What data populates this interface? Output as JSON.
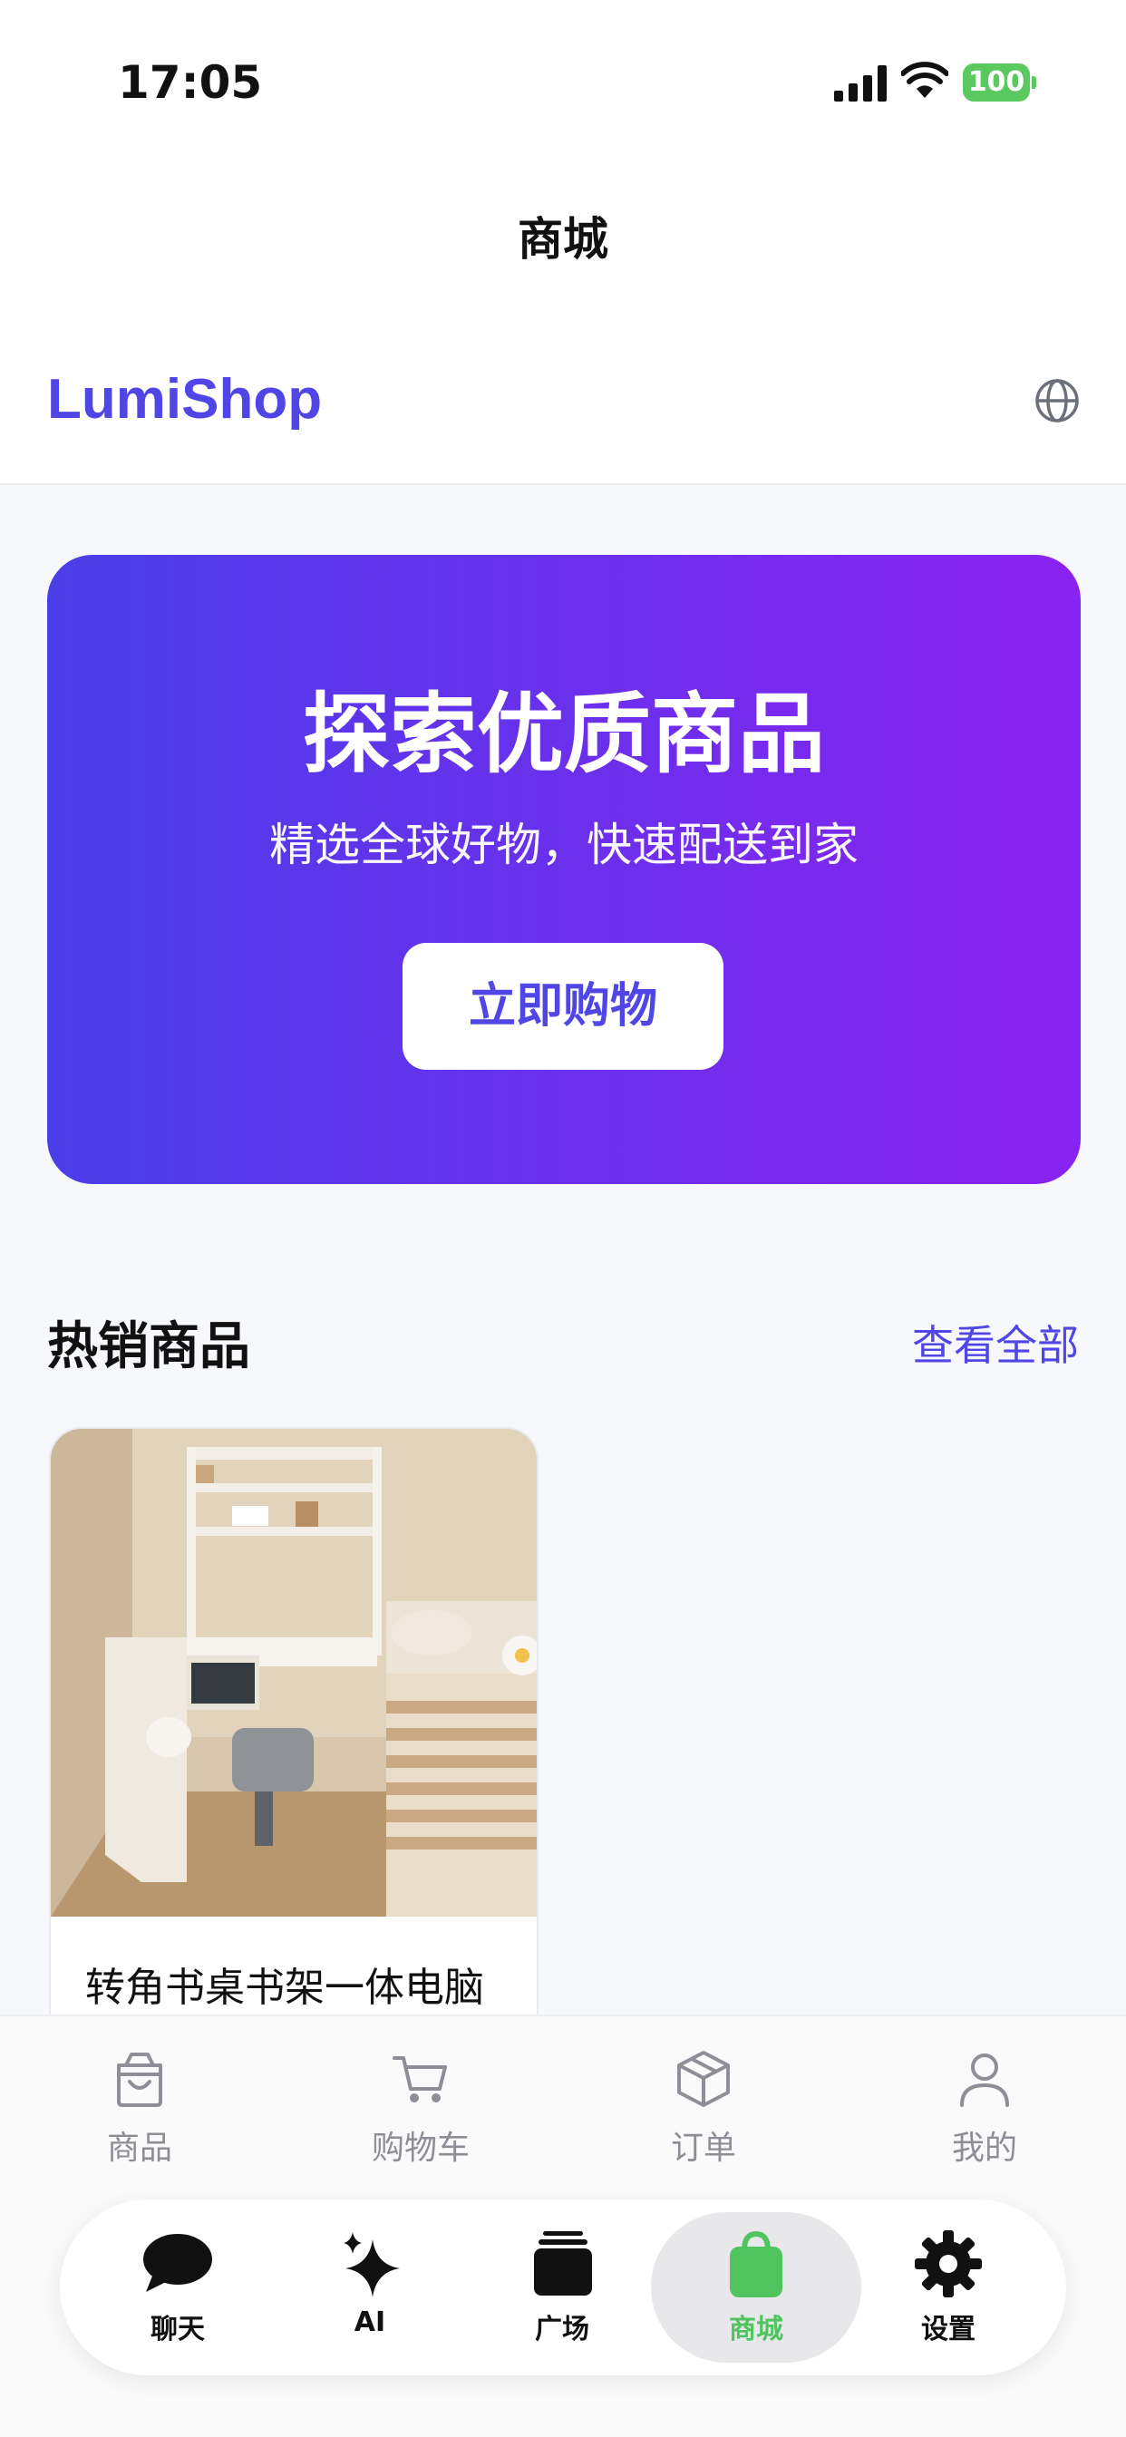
{
  "status_bar": {
    "time": "17:05",
    "battery": "100"
  },
  "nav": {
    "title": "商城"
  },
  "header": {
    "brand": "LumiShop",
    "language_icon": "globe-icon"
  },
  "hero": {
    "title": "探索优质商品",
    "subtitle": "精选全球好物，快速配送到家",
    "button_label": "立即购物"
  },
  "section": {
    "title": "热销商品",
    "view_all": "查看全部"
  },
  "products": [
    {
      "name": "转角书桌书架一体电脑"
    }
  ],
  "tabs": [
    {
      "label": "商品",
      "icon": "shopping-bag-icon"
    },
    {
      "label": "购物车",
      "icon": "cart-icon"
    },
    {
      "label": "订单",
      "icon": "package-icon"
    },
    {
      "label": "我的",
      "icon": "user-icon"
    }
  ],
  "dock": [
    {
      "label": "聊天",
      "icon": "chat-bubble-icon"
    },
    {
      "label": "AI",
      "icon": "sparkle-icon"
    },
    {
      "label": "广场",
      "icon": "stack-icon"
    },
    {
      "label": "商城",
      "icon": "shopping-bag-icon",
      "active": true
    },
    {
      "label": "设置",
      "icon": "gear-icon"
    }
  ],
  "colors": {
    "accent": "#4f46e5",
    "gradient_start": "#4a3ee8",
    "gradient_end": "#8a22f0",
    "active_dock": "#4fc45f"
  }
}
